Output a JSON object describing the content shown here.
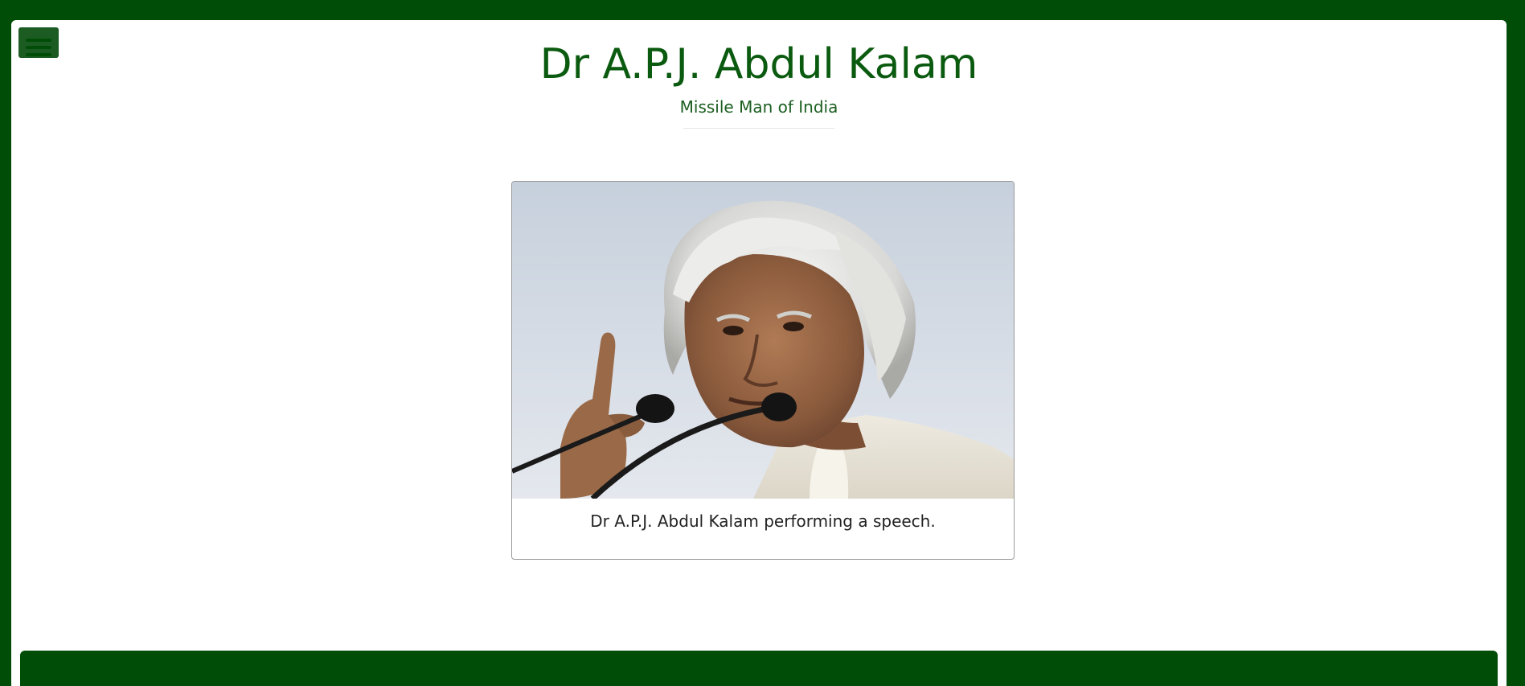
{
  "header": {
    "title": "Dr A.P.J. Abdul Kalam",
    "subtitle": "Missile Man of India"
  },
  "figure": {
    "image_alt": "Dr A.P.J. Abdul Kalam",
    "caption": "Dr A.P.J. Abdul Kalam performing a speech."
  },
  "menu": {
    "icon": "hamburger-menu-icon"
  },
  "colors": {
    "primary_green": "#004d08",
    "heading_green": "#0a5a0f",
    "background": "#ffffff"
  }
}
